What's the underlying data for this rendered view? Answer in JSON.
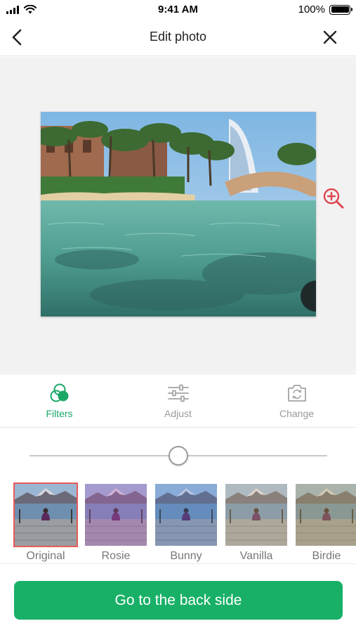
{
  "status_bar": {
    "time": "9:41 AM",
    "battery": "100%",
    "battery_level": 1.0
  },
  "header": {
    "title": "Edit photo",
    "back_icon": "chevron-left-icon",
    "close_icon": "close-icon"
  },
  "preview": {
    "zoom_icon": "zoom-in-icon"
  },
  "tools": [
    {
      "label": "Filters",
      "icon": "filters-icon",
      "active": true
    },
    {
      "label": "Adjust",
      "icon": "sliders-icon",
      "active": false
    },
    {
      "label": "Change",
      "icon": "camera-swap-icon",
      "active": false
    }
  ],
  "slider": {
    "value": 0.5
  },
  "filters": [
    {
      "name": "Original",
      "selected": true,
      "tint": "rgba(0,0,0,0)"
    },
    {
      "name": "Rosie",
      "selected": false,
      "tint": "rgba(190,90,200,0.30)"
    },
    {
      "name": "Bunny",
      "selected": false,
      "tint": "rgba(70,130,230,0.22)"
    },
    {
      "name": "Vanilla",
      "selected": false,
      "tint": "rgba(230,200,140,0.25)"
    },
    {
      "name": "Birdie",
      "selected": false,
      "tint": "rgba(200,170,90,0.32)"
    }
  ],
  "cta": {
    "label": "Go to the back side"
  },
  "colors": {
    "accent": "#18b067",
    "selected_border": "#e85a5a",
    "zoom": "#e0454f"
  }
}
